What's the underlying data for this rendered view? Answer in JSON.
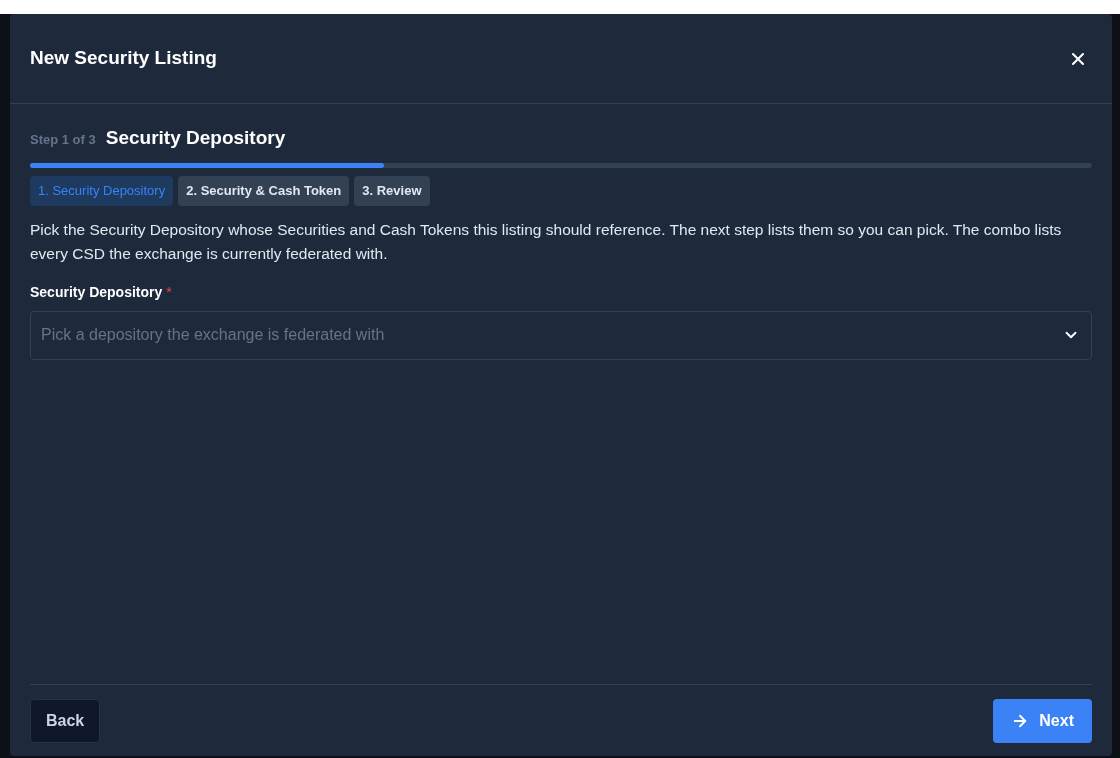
{
  "dialog": {
    "title": "New Security Listing"
  },
  "step": {
    "counter": "Step 1 of 3",
    "title": "Security Depository",
    "level": 0.333
  },
  "tabs": [
    {
      "label": "1. Security Depository",
      "selected": true
    },
    {
      "label": "2. Security & Cash Token",
      "selected": false
    },
    {
      "label": "3. Review",
      "selected": false
    }
  ],
  "description": "Pick the Security Depository whose Securities and Cash Tokens this listing should reference. The next step lists them so you can pick. The combo lists every CSD the exchange is currently federated with.",
  "field": {
    "label": "Security Depository",
    "required_mark": "*",
    "placeholder": "Pick a depository the exchange is federated with"
  },
  "buttons": {
    "back": "Back",
    "next": "Next"
  }
}
